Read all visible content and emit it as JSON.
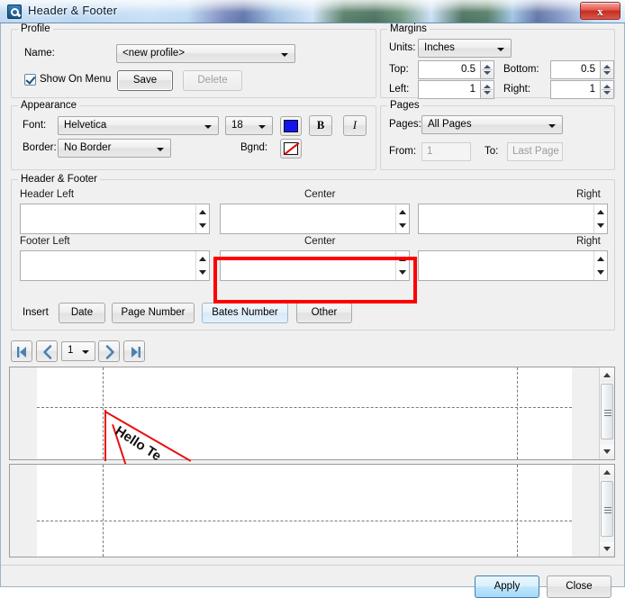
{
  "window": {
    "title": "Header & Footer",
    "icon": "app-icon",
    "close_label": "x"
  },
  "profile": {
    "legend": "Profile",
    "name_label": "Name:",
    "name_value": "<new profile>",
    "show_on_menu_label": "Show On Menu",
    "show_on_menu_checked": true,
    "save_label": "Save",
    "delete_label": "Delete"
  },
  "appearance": {
    "legend": "Appearance",
    "font_label": "Font:",
    "font_value": "Helvetica",
    "size_value": "18",
    "color_hex": "#1414f0",
    "bold_label": "B",
    "italic_label": "I",
    "border_label": "Border:",
    "border_value": "No Border",
    "bgnd_label": "Bgnd:",
    "bgnd_value": "none"
  },
  "margins": {
    "legend": "Margins",
    "units_label": "Units:",
    "units_value": "Inches",
    "top_label": "Top:",
    "top_value": "0.5",
    "bottom_label": "Bottom:",
    "bottom_value": "0.5",
    "left_label": "Left:",
    "left_value": "1",
    "right_label": "Right:",
    "right_value": "1"
  },
  "pages": {
    "legend": "Pages",
    "pages_label": "Pages:",
    "pages_value": "All Pages",
    "from_label": "From:",
    "from_value": "1",
    "to_label": "To:",
    "to_value": "Last Page"
  },
  "headerfooter": {
    "legend": "Header & Footer",
    "header_left_label": "Header Left",
    "header_center_label": "Center",
    "header_right_label": "Right",
    "footer_left_label": "Footer Left",
    "footer_center_label": "Center",
    "footer_right_label": "Right",
    "header_left_value": "",
    "header_center_value": "",
    "header_right_value": "",
    "footer_left_value": "",
    "footer_center_value": "",
    "footer_right_value": "",
    "insert_label": "Insert",
    "insert_buttons": [
      {
        "label": "Date"
      },
      {
        "label": "Page Number"
      },
      {
        "label": "Bates Number"
      },
      {
        "label": "Other"
      }
    ],
    "highlight_color": "#fe0000",
    "highlight_target": "footer-center-input"
  },
  "navigation": {
    "first_label": "first-page",
    "prev_label": "previous-page",
    "page_value": "1",
    "next_label": "next-page",
    "last_label": "last-page"
  },
  "preview": {
    "top_page_text": "Hello Te",
    "bottom_page_text": ""
  },
  "footer_buttons": {
    "apply_label": "Apply",
    "close_label": "Close"
  }
}
